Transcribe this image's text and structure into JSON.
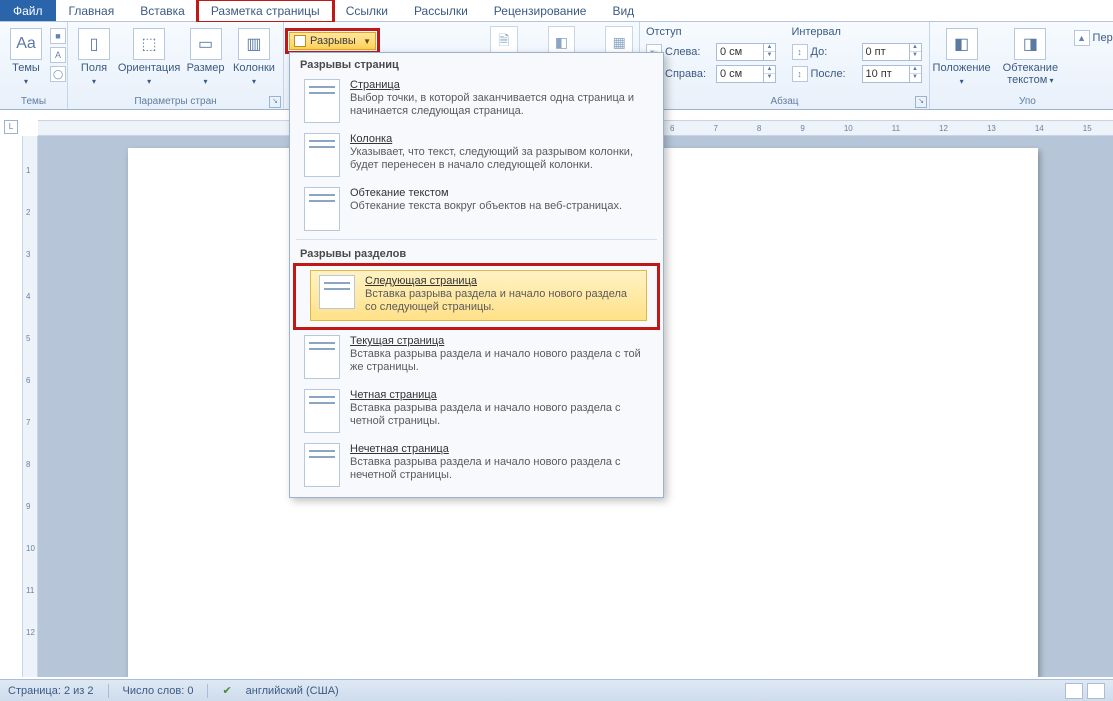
{
  "tabs": {
    "file": "Файл",
    "home": "Главная",
    "insert": "Вставка",
    "layout": "Разметка страницы",
    "references": "Ссылки",
    "mailings": "Рассылки",
    "review": "Рецензирование",
    "view": "Вид"
  },
  "ribbon": {
    "themes_group": "Темы",
    "themes_btn": "Темы",
    "page_setup_group": "Параметры стран",
    "margins": "Поля",
    "orientation": "Ориентация",
    "size": "Размер",
    "columns": "Колонки",
    "breaks_btn": "Разрывы",
    "indent_title": "Отступ",
    "left": "Слева:",
    "right": "Справа:",
    "left_val": "0 см",
    "right_val": "0 см",
    "spacing_title": "Интервал",
    "before": "До:",
    "after": "После:",
    "before_val": "0 пт",
    "after_val": "10 пт",
    "paragraph_group": "Абзац",
    "position": "Положение",
    "wrap": "Обтекание текстом",
    "arrange_group": "Упо",
    "bring_fwd": "Пере"
  },
  "dropdown": {
    "sec1": "Разрывы страниц",
    "page_t": "Страница",
    "page_d": "Выбор точки, в которой заканчивается одна страница и начинается следующая страница.",
    "col_t": "Колонка",
    "col_d": "Указывает, что текст, следующий за разрывом колонки, будет перенесен в начало следующей колонки.",
    "wrap_t": "Обтекание текстом",
    "wrap_d": "Обтекание текста вокруг объектов на веб-страницах.",
    "sec2": "Разрывы разделов",
    "next_t": "Следующая страница",
    "next_d": "Вставка разрыва раздела и начало нового раздела со следующей страницы.",
    "cont_t": "Текущая страница",
    "cont_d": "Вставка разрыва раздела и начало нового раздела с той же страницы.",
    "even_t": "Четная страница",
    "even_d": "Вставка разрыва раздела и начало нового раздела с четной страницы.",
    "odd_t": "Нечетная страница",
    "odd_d": "Вставка разрыва раздела и начало нового раздела с нечетной страницы."
  },
  "status": {
    "page": "Страница: 2 из 2",
    "words": "Число слов: 0",
    "lang": "английский (США)"
  },
  "ruler_corner": "⌐",
  "tab_selector": "L"
}
